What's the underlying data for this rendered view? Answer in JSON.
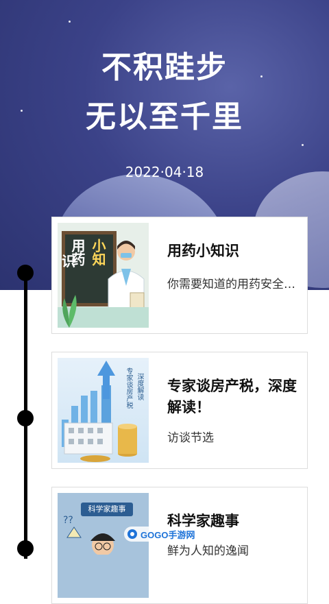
{
  "header": {
    "title_line1": "不积跬步",
    "title_line2": "无以至千里",
    "date": "2022·04·18"
  },
  "cards": [
    {
      "title": "用药小知识",
      "subtitle": "你需要知道的用药安全常识",
      "thumb_text_a": "用药",
      "thumb_text_b": "小知",
      "thumb_text_c": "识"
    },
    {
      "title": "专家谈房产税，深度解读！",
      "subtitle": "访谈节选",
      "thumb_text_a": "专家谈房产税",
      "thumb_text_b": "深度解读"
    },
    {
      "title": "科学家趣事",
      "subtitle": "鲜为人知的逸闻",
      "thumb_text_a": "科学家趣事"
    }
  ],
  "watermark": {
    "text": "GOGO手游网"
  },
  "colors": {
    "hero": "#3b4288",
    "timeline": "#000000",
    "accent": "#1e73d8"
  }
}
